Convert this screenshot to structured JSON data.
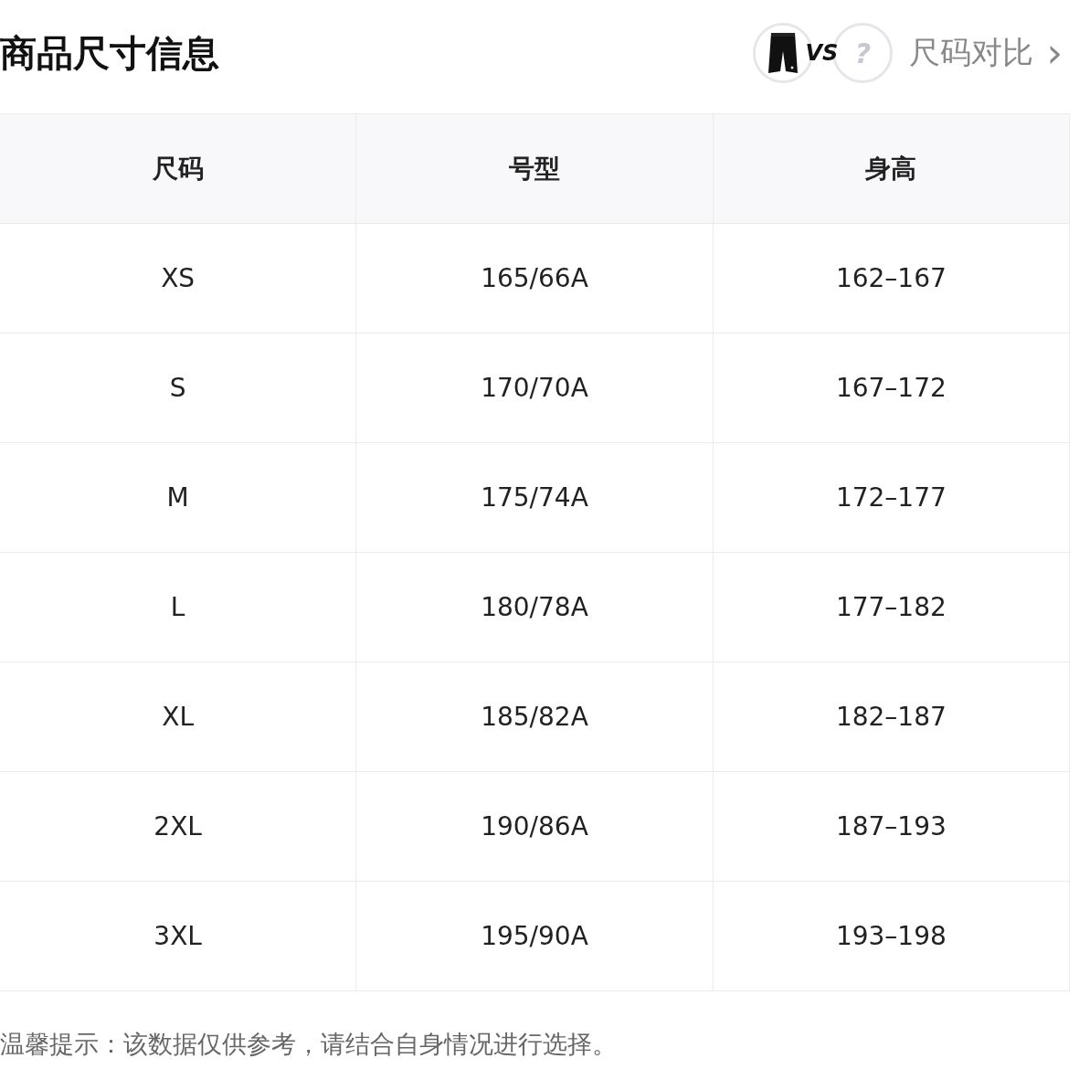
{
  "title": "商品尺寸信息",
  "compare": {
    "vs": "VS",
    "unknown": "?",
    "label": "尺码对比",
    "chevron": "›"
  },
  "table": {
    "columns": [
      "尺码",
      "号型",
      "身高"
    ],
    "rows": [
      [
        "XS",
        "165/66A",
        "162–167"
      ],
      [
        "S",
        "170/70A",
        "167–172"
      ],
      [
        "M",
        "175/74A",
        "172–177"
      ],
      [
        "L",
        "180/78A",
        "177–182"
      ],
      [
        "XL",
        "185/82A",
        "182–187"
      ],
      [
        "2XL",
        "190/86A",
        "187–193"
      ],
      [
        "3XL",
        "195/90A",
        "193–198"
      ]
    ]
  },
  "note": "温馨提示：该数据仅供参考，请结合自身情况进行选择。"
}
